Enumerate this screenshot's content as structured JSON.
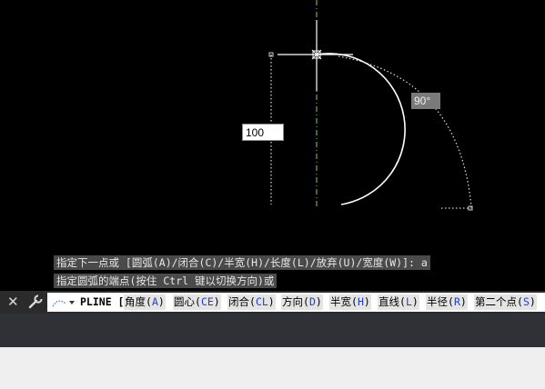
{
  "drawing": {
    "dynamic_input_value": "100",
    "angle_tooltip": "90°"
  },
  "history": {
    "line1": "指定下一点或 [圆弧(A)/闭合(C)/半宽(H)/长度(L)/放弃(U)/宽度(W)]: a",
    "line2": "指定圆弧的端点(按住 Ctrl 键以切换方向)或"
  },
  "command_line": {
    "prompt": "PLINE [",
    "options": [
      {
        "label": "角度(",
        "key": "A",
        "tail": ")"
      },
      {
        "label": "圆心(",
        "key": "CE",
        "tail": ")"
      },
      {
        "label": "闭合(",
        "key": "CL",
        "tail": ")"
      },
      {
        "label": "方向(",
        "key": "D",
        "tail": ")"
      },
      {
        "label": "半宽(",
        "key": "H",
        "tail": ")"
      },
      {
        "label": "直线(",
        "key": "L",
        "tail": ")"
      },
      {
        "label": "半径(",
        "key": "R",
        "tail": ")"
      },
      {
        "label": "第二个点(",
        "key": "S",
        "tail": ")"
      }
    ]
  },
  "icons": {
    "close": "close-icon",
    "customize": "wrench-icon",
    "recent": "recent-commands-icon"
  },
  "colors": {
    "canvas": "#000000",
    "crosshair": "#ffffff",
    "ucs_axis": "#7fd44c",
    "option_key": "#1d3fd6"
  }
}
